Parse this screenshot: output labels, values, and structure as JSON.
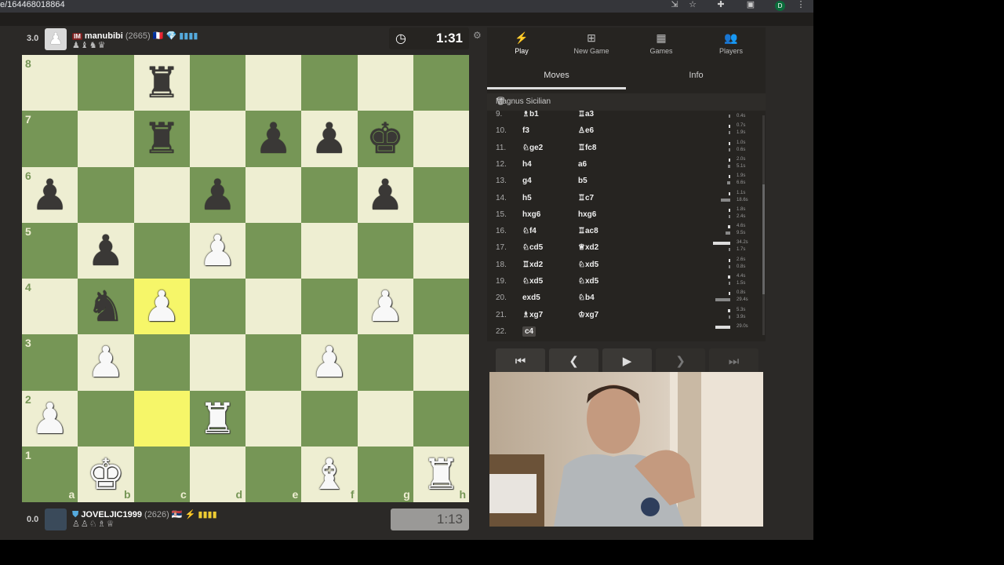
{
  "browser": {
    "url": "e/164468018864",
    "icons": [
      "install-icon",
      "star-icon",
      "extensions-icon",
      "screenshot-icon",
      "profile-avatar",
      "menu-icon"
    ],
    "profile_letter": "D"
  },
  "top_player": {
    "score": "3.0",
    "title": "IM",
    "name": "manubibi",
    "rating": "(2665)",
    "flag": "🇫🇷",
    "badges": "💎 ▮▮▮▮",
    "captured": "♟♝♞♛",
    "clock": "1:31"
  },
  "bottom_player": {
    "score": "0.0",
    "name": "JOVELJIC1999",
    "rating": "(2626)",
    "flag": "🇷🇸",
    "badges": "⚡ ▮▮▮▮",
    "captured": "♙♙♘♗♕",
    "clock": "1:13"
  },
  "board": {
    "light": "#eeeed2",
    "dark": "#769656",
    "highlight": "#f6f669",
    "ranks": [
      "8",
      "7",
      "6",
      "5",
      "4",
      "3",
      "2",
      "1"
    ],
    "files": [
      "a",
      "b",
      "c",
      "d",
      "e",
      "f",
      "g",
      "h"
    ],
    "highlighted": [
      "c4",
      "c2"
    ],
    "pieces": [
      {
        "sq": "c8",
        "p": "♜",
        "c": "b"
      },
      {
        "sq": "c7",
        "p": "♜",
        "c": "b"
      },
      {
        "sq": "e7",
        "p": "♟",
        "c": "b"
      },
      {
        "sq": "f7",
        "p": "♟",
        "c": "b"
      },
      {
        "sq": "g7",
        "p": "♚",
        "c": "b"
      },
      {
        "sq": "a6",
        "p": "♟",
        "c": "b"
      },
      {
        "sq": "d6",
        "p": "♟",
        "c": "b"
      },
      {
        "sq": "g6",
        "p": "♟",
        "c": "b"
      },
      {
        "sq": "b5",
        "p": "♟",
        "c": "b"
      },
      {
        "sq": "d5",
        "p": "♟",
        "c": "w"
      },
      {
        "sq": "b4",
        "p": "♞",
        "c": "b"
      },
      {
        "sq": "c4",
        "p": "♟",
        "c": "w"
      },
      {
        "sq": "g4",
        "p": "♟",
        "c": "w"
      },
      {
        "sq": "b3",
        "p": "♟",
        "c": "w"
      },
      {
        "sq": "f3",
        "p": "♟",
        "c": "w"
      },
      {
        "sq": "a2",
        "p": "♟",
        "c": "w"
      },
      {
        "sq": "d2",
        "p": "♜",
        "c": "w"
      },
      {
        "sq": "b1",
        "p": "♚",
        "c": "w"
      },
      {
        "sq": "f1",
        "p": "♝",
        "c": "w"
      },
      {
        "sq": "h1",
        "p": "♜",
        "c": "w"
      }
    ]
  },
  "nav": [
    {
      "label": "Play",
      "icon": "⚡",
      "active": true
    },
    {
      "label": "New Game",
      "icon": "⊞",
      "active": false
    },
    {
      "label": "Games",
      "icon": "▦",
      "active": false
    },
    {
      "label": "Players",
      "icon": "👥",
      "active": false
    }
  ],
  "subtabs": {
    "moves": "Moves",
    "info": "Info"
  },
  "opening": "Magnus Sicilian",
  "moves": [
    {
      "n": "9.",
      "w": "♗b1",
      "b": "♖a3",
      "wt": "",
      "bt": "0.4s",
      "wv": 0,
      "bv": 0.01
    },
    {
      "n": "10.",
      "w": "f3",
      "b": "♙e6",
      "wt": "0.7s",
      "bt": "1.9s",
      "wv": 0.02,
      "bv": 0.05
    },
    {
      "n": "11.",
      "w": "♘ge2",
      "b": "♖fc8",
      "wt": "1.0s",
      "bt": "0.6s",
      "wv": 0.03,
      "bv": 0.02
    },
    {
      "n": "12.",
      "w": "h4",
      "b": "a6",
      "wt": "2.0s",
      "bt": "5.1s",
      "wv": 0.06,
      "bv": 0.15
    },
    {
      "n": "13.",
      "w": "g4",
      "b": "b5",
      "wt": "1.9s",
      "bt": "6.6s",
      "wv": 0.05,
      "bv": 0.19
    },
    {
      "n": "14.",
      "w": "h5",
      "b": "♖c7",
      "wt": "1.1s",
      "bt": "18.6s",
      "wv": 0.03,
      "bv": 0.54
    },
    {
      "n": "15.",
      "w": "hxg6",
      "b": "hxg6",
      "wt": "1.8s",
      "bt": "2.4s",
      "wv": 0.05,
      "bv": 0.07
    },
    {
      "n": "16.",
      "w": "♘f4",
      "b": "♖ac8",
      "wt": "4.6s",
      "bt": "9.5s",
      "wv": 0.13,
      "bv": 0.28
    },
    {
      "n": "17.",
      "w": "♘cd5",
      "b": "♕xd2",
      "wt": "34.2s",
      "bt": "1.7s",
      "wv": 1,
      "bv": 0.05
    },
    {
      "n": "18.",
      "w": "♖xd2",
      "b": "♘xd5",
      "wt": "2.6s",
      "bt": "0.8s",
      "wv": 0.08,
      "bv": 0.02
    },
    {
      "n": "19.",
      "w": "♘xd5",
      "b": "♘xd5",
      "wt": "4.4s",
      "bt": "1.5s",
      "wv": 0.13,
      "bv": 0.04
    },
    {
      "n": "20.",
      "w": "exd5",
      "b": "♘b4",
      "wt": "0.8s",
      "bt": "29.4s",
      "wv": 0.02,
      "bv": 0.86
    },
    {
      "n": "21.",
      "w": "♗xg7",
      "b": "♔xg7",
      "wt": "5.3s",
      "bt": "3.9s",
      "wv": 0.15,
      "bv": 0.11
    },
    {
      "n": "22.",
      "w": "c4",
      "b": "",
      "wt": "29.0s",
      "bt": "",
      "wv": 0.85,
      "bv": 0
    }
  ],
  "controls": {
    "first": "⏮",
    "prev": "❮",
    "play": "▶",
    "next": "❯",
    "last": "⏭"
  }
}
